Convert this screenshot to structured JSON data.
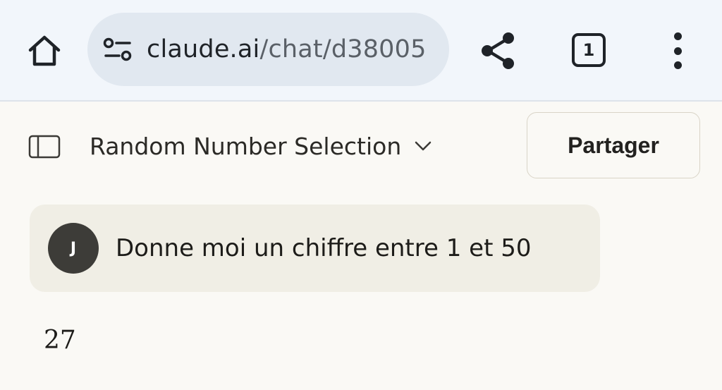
{
  "browser": {
    "url_domain": "claude.ai",
    "url_path": "/chat/d3800",
    "url_trailing": "5",
    "tab_count": "1",
    "icons": [
      "home-icon",
      "site-settings-icon",
      "share-icon",
      "tab-switcher-icon",
      "more-vert-icon"
    ]
  },
  "header": {
    "title": "Random Number Selection",
    "share_label": "Partager",
    "icons": [
      "sidebar-toggle-icon",
      "chevron-down-icon"
    ]
  },
  "conversation": {
    "user": {
      "avatar_initial": "J",
      "message": "Donne moi un chiffre entre 1 et 50"
    },
    "assistant": {
      "message": "27"
    }
  },
  "colors": {
    "browser_bar": "#f2f6fb",
    "url_pill": "#e1e8f0",
    "page_background": "#faf9f5",
    "user_bubble": "#f0eee5",
    "avatar": "#3d3c38"
  }
}
